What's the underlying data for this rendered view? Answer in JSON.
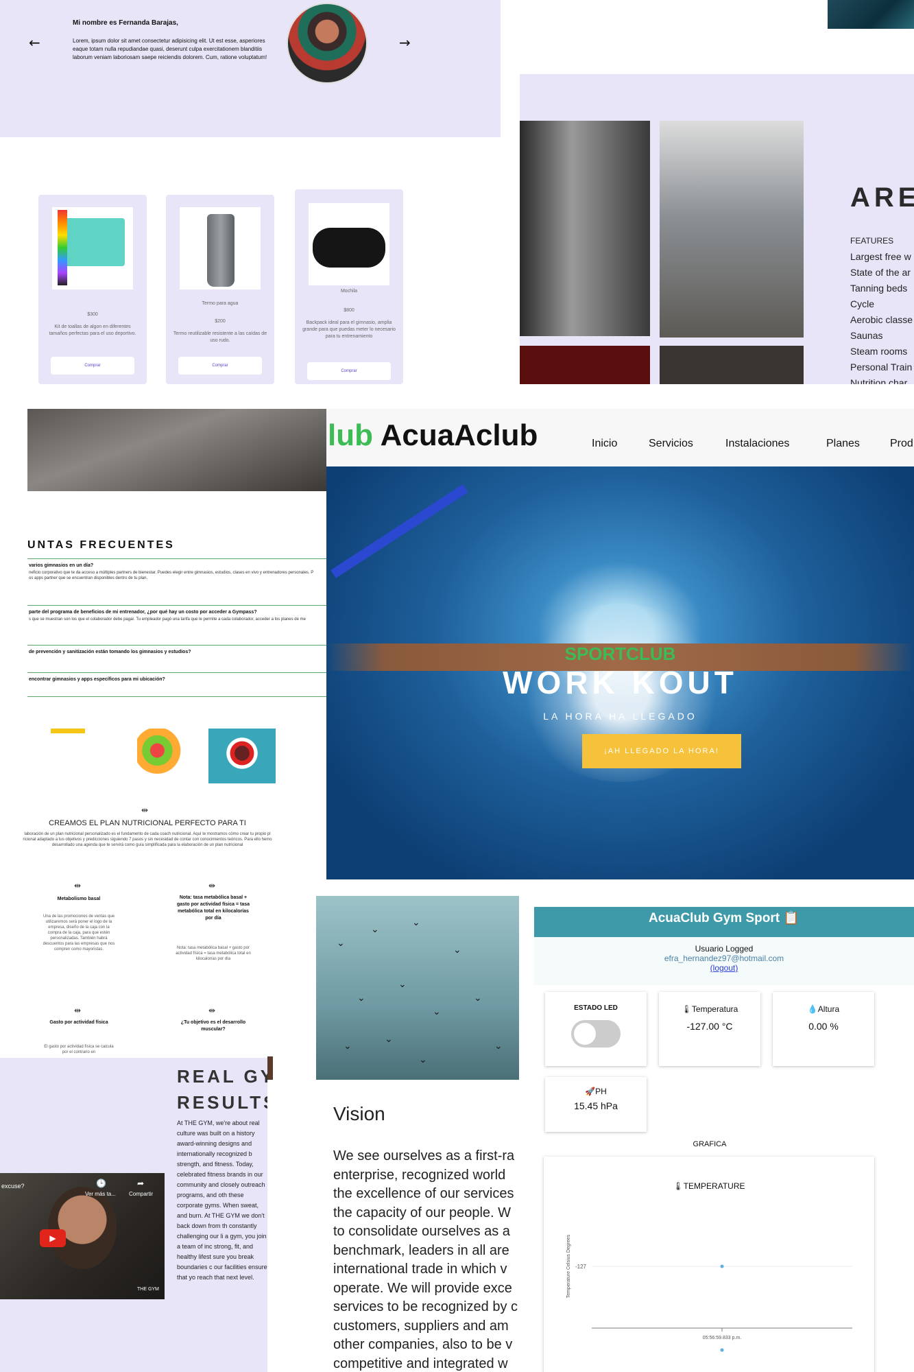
{
  "testimonial": {
    "name": "Mi nombre es Fernanda Barajas,",
    "text": "Lorem, ipsum dolor sit amet consectetur adipisicing elit. Ut est esse, asperiores eaque totam nulla repudiandae quasi, deserunt culpa exercitationem blanditiis laborum veniam laboriosam saepe reiciendis dolorem. Cum, ratione voluptatum!",
    "prev_icon": "←",
    "next_icon": "→"
  },
  "products": [
    {
      "name": "",
      "price": "$300",
      "desc": "Kit de toallas de algon en diferentes tamaños perfectas para el uso deportivo.",
      "button": "Comprar"
    },
    {
      "name": "Termo para agua",
      "price": "$200",
      "desc": "Termo reutilizable resistente a las caídas de uso rudo.",
      "button": "Comprar"
    },
    {
      "name": "Mochila",
      "price": "$800",
      "desc": "Backpack ideal para el gimnasio, amplia grande para que puedas meter lo necesario para tu entrenamiento",
      "button": "Comprar"
    }
  ],
  "features": {
    "title": "ARE",
    "items": [
      "FEATURES",
      "Largest free w",
      "State of the ar",
      "Tanning beds",
      "Cycle",
      "Aerobic classe",
      "Saunas",
      "Steam rooms",
      "Personal Train",
      "Nutrition char"
    ]
  },
  "faq": {
    "title": "UNTAS FRECUENTES",
    "items": [
      {
        "q": "varios gimnasios en un día?",
        "a": "neficio corporativo que te da acceso a múltiples partners de bienestar. Puedes elegir entre gimnasios, estudios, clases en vivo y entrenadores personales. P\nos apps partner que se encuentran disponibles dentro de tu plan."
      },
      {
        "q": "parte del programa de beneficios de mi entrenador, ¿por qué hay un costo por acceder a Gympass?",
        "a": "s que se muestran son los que el colaborador debe pagar. Tu empleador pagó una tarifa que le permite a cada colaborador, acceder a los planes de me"
      },
      {
        "q": "de prevención y sanitización están tomando los gimnasios y estudios?",
        "a": ""
      },
      {
        "q": "encontrar gimnasios y apps específicos para mi ubicación?",
        "a": ""
      }
    ]
  },
  "nutrition": {
    "title": "CREAMOS EL PLAN NUTRICIONAL PERFECTO PARA TI",
    "desc": "laboración de un plan nutricional personalizado es el fundamento de cada coach nutricional. Aquí te mostramos cómo crear tu propio pl\nricional adaptado a tus objetivos y predicciones siguiendo 7 pasos y sin necesidad de contar con conocimientos teóricos. Para ello hemo\ndesarrollado una agenda que te servirá como guía simplificada para la elaboración de un plan nutricional",
    "icon": "⇹",
    "blocks": [
      {
        "h": "Metabolismo basal",
        "p": "Una de las promociones de ventas que utilizaremos será poner el logo de la empresa, diseño de la caja con la compra de la caja, para que estén personalizadas. También habrá descuentos para las empresas que nos compren como mayoristas."
      },
      {
        "h": "Nota: tasa metabólica basal + gasto por actividad física = tasa metabólica total en kilocalorías por día",
        "p": "Nota: tasa metabólica basal + gasto por actividad física = tasa metabólica total en kilocalorías por día"
      },
      {
        "h": "Gasto por actividad física",
        "p": "El gasto por actividad física se calcula por el contrario en"
      },
      {
        "h": "¿Tu objetivo es el desarrollo muscular?",
        "p": ""
      }
    ]
  },
  "hero": {
    "logo_green": "lub",
    "logo_black": " AcuaAclub",
    "nav": [
      "Inicio",
      "Servicios",
      "Instalaciones",
      "Planes",
      "Prod"
    ],
    "subtitle": "SPORTCLUB",
    "title": "WORK KOUT",
    "tagline": "LA HORA HA LLEGADO",
    "button": "¡AH LLEGADO LA HORA!"
  },
  "results": {
    "title_line1": "REAL GY",
    "title_line2": "RESULTS",
    "text": "At THE GYM, we're about real culture was built on a history award-winning designs and internationally recognized b strength, and fitness. Today, celebrated fitness brands in our community and closely outreach programs, and oth these corporate gyms. When sweat, and burn. At THE GYM we don't back down from th constantly challenging our li a gym, you join a team of inc strong, fit, and healthy lifest sure you break boundaries c our facilities ensure that yo reach that next level.",
    "video_title": "excuse?",
    "watch_later": "Ver más ta...",
    "share": "Compartir",
    "brand": "THE GYM"
  },
  "vision": {
    "title": "Vision",
    "lines": [
      "We see ourselves as a first-ra",
      "enterprise, recognized world",
      "the excellence of our services",
      "the capacity of our people. W",
      "to consolidate ourselves as a",
      "benchmark, leaders in all are",
      "international trade in which v",
      "operate. We will provide exce",
      "services to be recognized by c",
      "customers, suppliers and am",
      "other companies, also to be v",
      "competitive and integrated w"
    ]
  },
  "dashboard": {
    "header": "AcuaClub Gym Sport 📋",
    "user_label": "Usuario Logged",
    "email": "efra_hernandez97@hotmail.com",
    "logout": "(logout)",
    "led_label": "ESTADO LED",
    "temp_label": "🌡Temperatura",
    "temp_value": "-127.00 °C",
    "alt_label": "💧Altura",
    "alt_value": "0.00 %",
    "ph_label": "🚀PH",
    "ph_value": "15.45 hPa",
    "grafica": "GRAFICA",
    "led_on": false
  },
  "chart_data": {
    "type": "line",
    "title": "🌡TEMPERATURE",
    "ylabel": "Temperature Celsius Degrees",
    "x": [
      "05:56:59.833 p.m."
    ],
    "series": [
      {
        "name": "",
        "values": [
          -127
        ]
      }
    ],
    "y_ticks": [
      -127
    ]
  }
}
